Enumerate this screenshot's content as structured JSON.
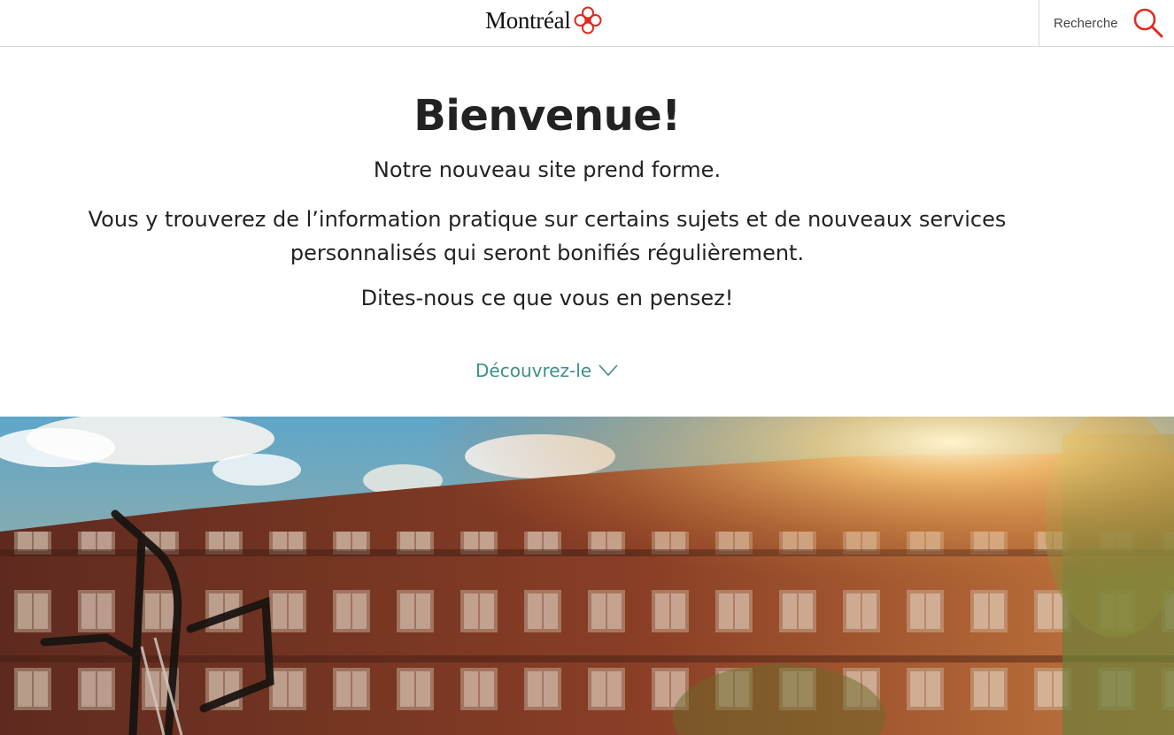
{
  "header": {
    "logo_text": "Montréal",
    "search_label": "Recherche"
  },
  "hero": {
    "title": "Bienvenue!",
    "subtitle": "Notre nouveau site prend forme.",
    "body": "Vous y trouverez de l’information pratique sur certains sujets et de nouveaux services personnalisés qui seront bonifiés régulièrement.",
    "cta": "Dites-nous ce que vous en pensez!",
    "discover_label": "Découvrez-le"
  },
  "colors": {
    "brand_red": "#e02b20",
    "link_teal": "#3e8f88",
    "text_dark": "#222222"
  },
  "icons": [
    "rosette-logo-icon",
    "search-icon",
    "chevron-down-icon"
  ]
}
